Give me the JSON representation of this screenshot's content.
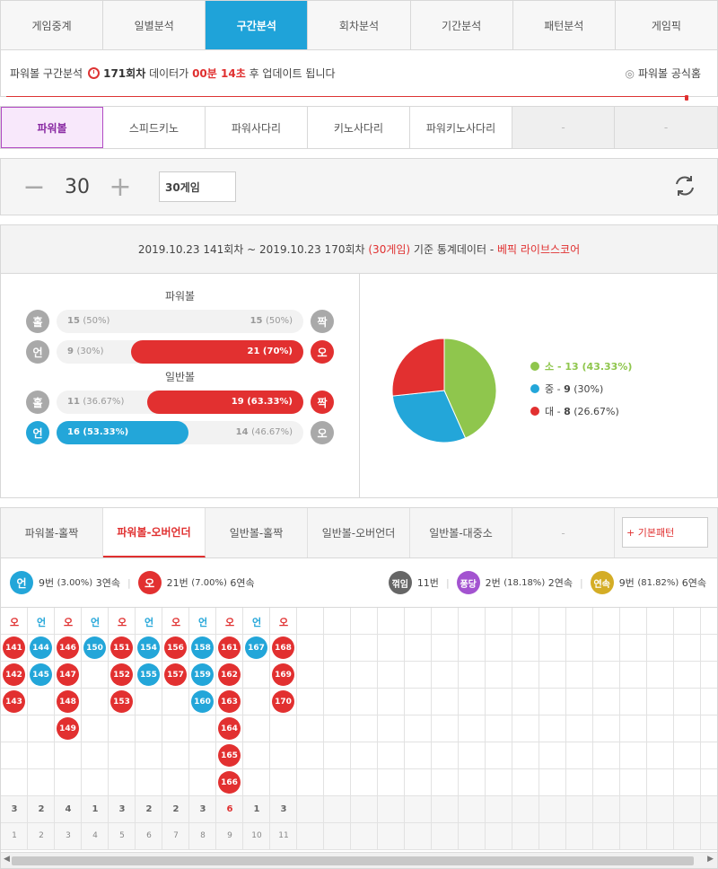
{
  "nav_tabs": [
    "게임중계",
    "일별분석",
    "구간분석",
    "회차분석",
    "기간분석",
    "패턴분석",
    "게임픽"
  ],
  "info": {
    "prefix": "파워볼 구간분석",
    "round": "171회차",
    "mid": "데이터가",
    "time": "00분 14초",
    "suffix": "후 업데이트 됩니다",
    "official": "파워볼 공식홈"
  },
  "sub_tabs": [
    "파워볼",
    "스피드키노",
    "파워사다리",
    "키노사다리",
    "파워키노사다리",
    "-",
    "-"
  ],
  "counter": {
    "value": "30",
    "games": "30게임"
  },
  "stats_header": {
    "range": "2019.10.23 141회차 ~ 2019.10.23 170회차",
    "count": "(30게임)",
    "basis": "기준 통계데이터 -",
    "brand": "베픽 라이브스코어"
  },
  "powerball": {
    "title": "파워볼",
    "oddeven": {
      "left": "홀",
      "right": "짝",
      "left_val": "15",
      "left_pct": "(50%)",
      "right_val": "15",
      "right_pct": "(50%)",
      "right_frac": 0.5
    },
    "underover": {
      "left": "언",
      "right": "오",
      "left_val": "9",
      "left_pct": "(30%)",
      "right_val": "21",
      "right_pct": "(70%)",
      "right_frac": 0.7
    }
  },
  "normalball": {
    "title": "일반볼",
    "oddeven": {
      "left": "홀",
      "right": "짝",
      "left_val": "11",
      "left_pct": "(36.67%)",
      "right_val": "19",
      "right_pct": "(63.33%)",
      "right_frac": 0.6333
    },
    "underover": {
      "left": "언",
      "right": "오",
      "left_val": "16",
      "left_pct": "(53.33%)",
      "right_val": "14",
      "right_pct": "(46.67%)",
      "left_frac": 0.5333
    }
  },
  "pie": {
    "slices": [
      {
        "label": "소",
        "value": 13,
        "pct": "(43.33%)",
        "color": "#8fc64d"
      },
      {
        "label": "중",
        "value": 9,
        "pct": "(30%)",
        "color": "#23a6d9"
      },
      {
        "label": "대",
        "value": 8,
        "pct": "(26.67%)",
        "color": "#e23030"
      }
    ]
  },
  "pattern_tabs": [
    "파워볼-홀짝",
    "파워볼-오버언더",
    "일반볼-홀짝",
    "일반볼-오버언더",
    "일반볼-대중소",
    "-"
  ],
  "basic_pattern": "+ 기본패턴",
  "summary": {
    "under": {
      "icon": "언",
      "count": "9번",
      "pct": "(3.00%)",
      "streak": "3연속"
    },
    "over": {
      "icon": "오",
      "count": "21번",
      "pct": "(7.00%)",
      "streak": "6연속"
    },
    "bend": {
      "icon": "꺾임",
      "count": "11번"
    },
    "pong": {
      "icon": "퐁당",
      "count": "2번",
      "pct": "(18.18%)",
      "streak": "2연속"
    },
    "cont": {
      "icon": "연속",
      "count": "9번",
      "pct": "(81.82%)",
      "streak": "6연속"
    }
  },
  "columns": [
    {
      "h": "오",
      "t": "r",
      "v": [
        "141",
        "142",
        "143"
      ]
    },
    {
      "h": "언",
      "t": "b",
      "v": [
        "144",
        "145"
      ]
    },
    {
      "h": "오",
      "t": "r",
      "v": [
        "146",
        "147",
        "148",
        "149"
      ]
    },
    {
      "h": "언",
      "t": "b",
      "v": [
        "150"
      ]
    },
    {
      "h": "오",
      "t": "r",
      "v": [
        "151",
        "152",
        "153"
      ]
    },
    {
      "h": "언",
      "t": "b",
      "v": [
        "154",
        "155"
      ]
    },
    {
      "h": "오",
      "t": "r",
      "v": [
        "156",
        "157"
      ]
    },
    {
      "h": "언",
      "t": "b",
      "v": [
        "158",
        "159",
        "160"
      ]
    },
    {
      "h": "오",
      "t": "r",
      "v": [
        "161",
        "162",
        "163",
        "164",
        "165",
        "166"
      ]
    },
    {
      "h": "언",
      "t": "b",
      "v": [
        "167"
      ]
    },
    {
      "h": "오",
      "t": "r",
      "v": [
        "168",
        "169",
        "170"
      ]
    }
  ],
  "counts": [
    "3",
    "2",
    "4",
    "1",
    "3",
    "2",
    "2",
    "3",
    "6",
    "1",
    "3"
  ],
  "indices": [
    "1",
    "2",
    "3",
    "4",
    "5",
    "6",
    "7",
    "8",
    "9",
    "10",
    "11"
  ]
}
